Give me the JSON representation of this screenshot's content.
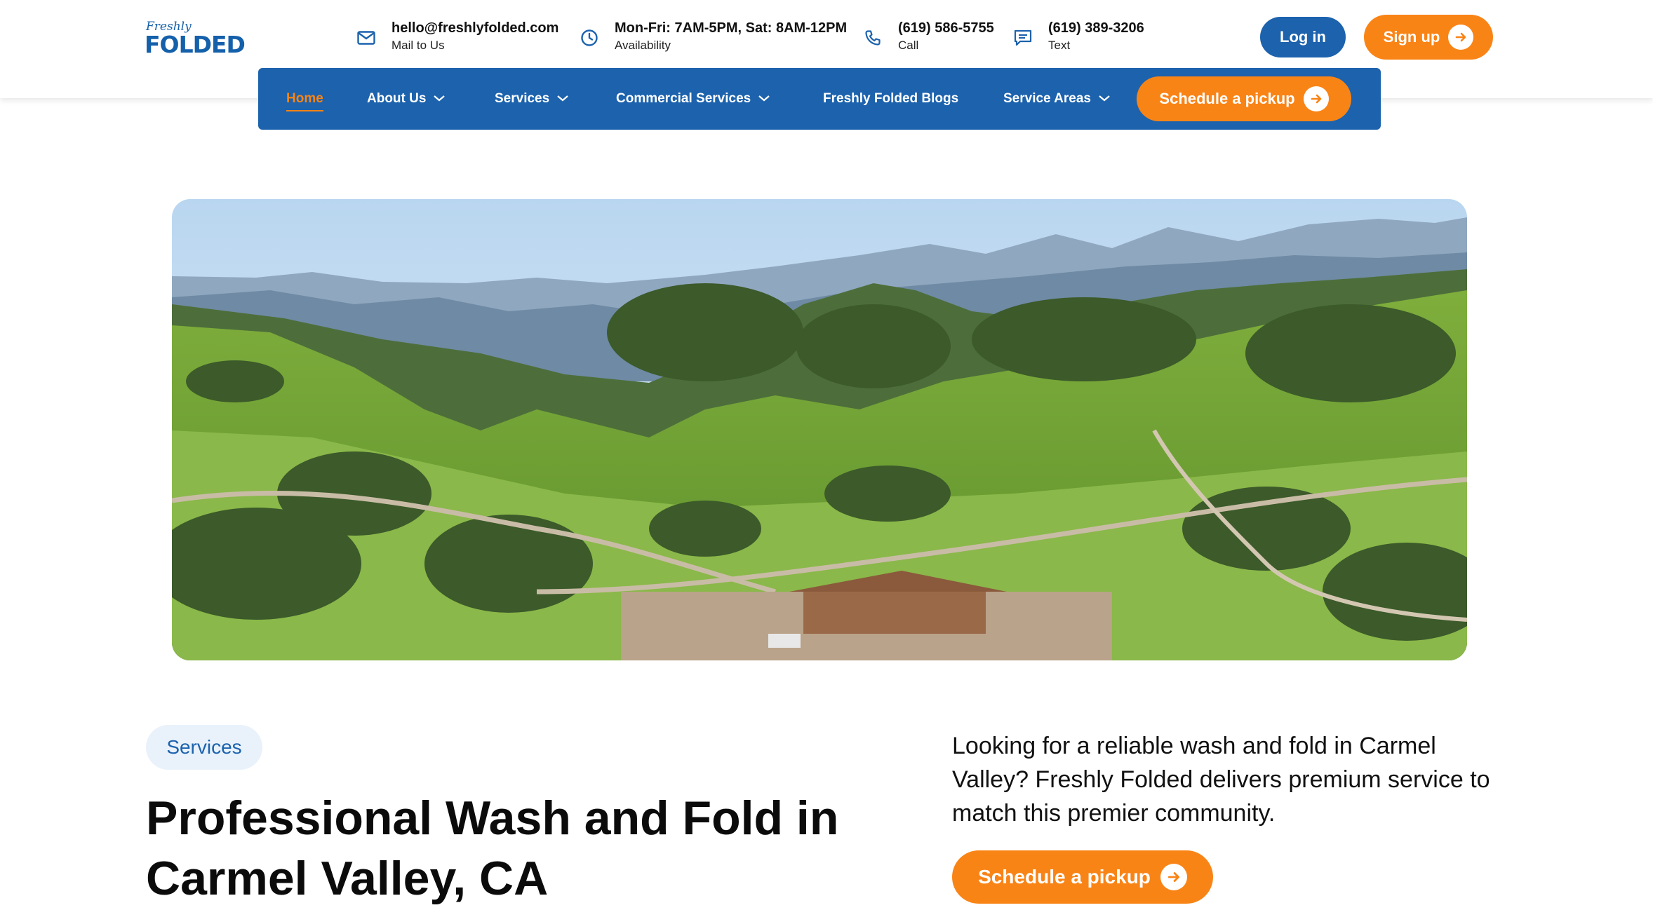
{
  "brand": {
    "script": "Freshly",
    "word": "FOLDED"
  },
  "contacts": [
    {
      "main": "hello@freshlyfolded.com",
      "sub": "Mail to Us",
      "icon": "mail-icon"
    },
    {
      "main": "Mon-Fri: 7AM-5PM, Sat: 8AM-12PM",
      "sub": "Availability",
      "icon": "clock-icon"
    },
    {
      "main": "(619) 586-5755",
      "sub": "Call",
      "icon": "phone-icon"
    },
    {
      "main": "(619) 389-3206",
      "sub": "Text",
      "icon": "message-icon"
    }
  ],
  "auth": {
    "login": "Log in",
    "signup": "Sign up"
  },
  "nav": {
    "items": [
      {
        "label": "Home",
        "active": true,
        "dropdown": false
      },
      {
        "label": "About Us",
        "active": false,
        "dropdown": true
      },
      {
        "label": "Services",
        "active": false,
        "dropdown": true
      },
      {
        "label": "Commercial Services",
        "active": false,
        "dropdown": true
      },
      {
        "label": "Freshly Folded Blogs",
        "active": false,
        "dropdown": false
      },
      {
        "label": "Service Areas",
        "active": false,
        "dropdown": true
      }
    ],
    "cta": "Schedule a pickup"
  },
  "hero": {
    "pill": "Services",
    "title_line1": "Professional Wash and Fold in",
    "title_line2": "Carmel Valley, CA",
    "intro": "Looking for a reliable wash and fold in Carmel Valley? Freshly Folded delivers premium service to match this premier community.",
    "cta": "Schedule a pickup"
  },
  "colors": {
    "primary": "#1c62ad",
    "accent": "#f98416",
    "pill_bg": "#e9f2fb",
    "text": "#111111"
  }
}
